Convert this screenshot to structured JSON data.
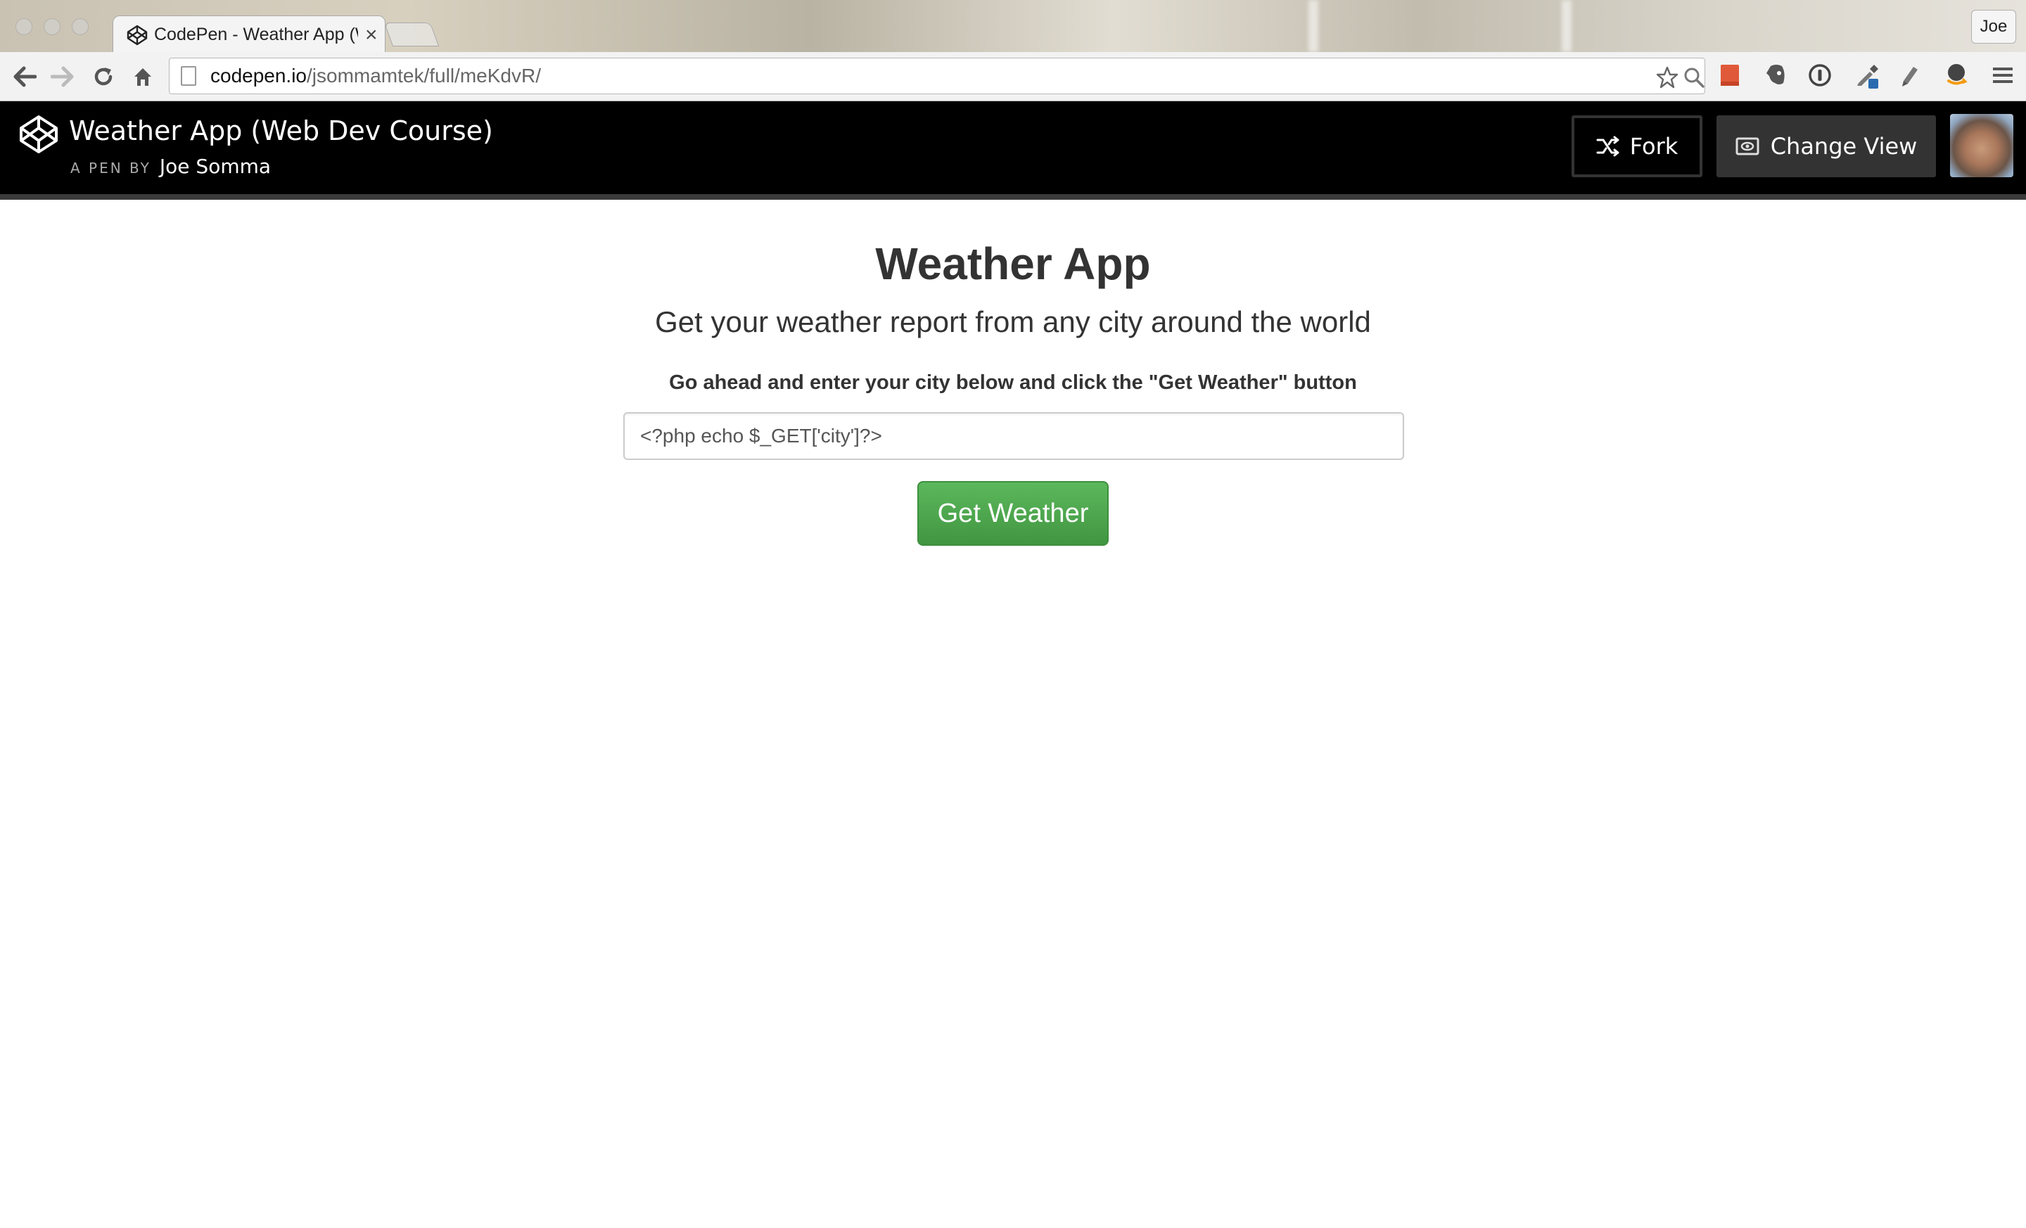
{
  "browser": {
    "tab_title": "CodePen - Weather App (Web Dev Course)",
    "tab_close": "×",
    "profile_name": "Joe",
    "url_host": "codepen.io",
    "url_path": "/jsommamtek/full/meKdvR/"
  },
  "codepen": {
    "pen_title": "Weather App (Web Dev Course)",
    "byline": "A PEN BY",
    "author": "Joe Somma",
    "fork_label": "Fork",
    "change_view_label": "Change View"
  },
  "page": {
    "title": "Weather App",
    "subtitle": "Get your weather report from any city around the world",
    "instruction": "Go ahead and enter your city below and click the \"Get Weather\" button",
    "city_input_value": "<?php echo $_GET['city']?>",
    "button_label": "Get Weather"
  },
  "colors": {
    "header_bg": "#000000",
    "button_green": "#4cae4c",
    "text_dark": "#333333"
  }
}
